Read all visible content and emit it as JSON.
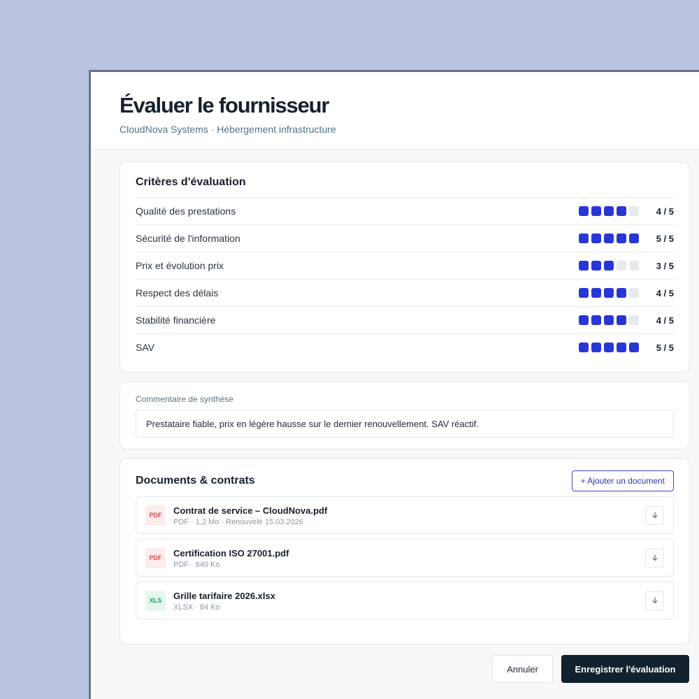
{
  "header": {
    "title": "Évaluer le fournisseur",
    "subtitle": "CloudNova Systems · Hébergement infrastructure"
  },
  "criteria": {
    "title": "Critères d'évaluation",
    "max": 5,
    "items": [
      {
        "label": "Qualité des prestations",
        "value": 4,
        "score": "4 / 5"
      },
      {
        "label": "Sécurité de l'information",
        "value": 5,
        "score": "5 / 5"
      },
      {
        "label": "Prix et évolution prix",
        "value": 3,
        "score": "3 / 5"
      },
      {
        "label": "Respect des délais",
        "value": 4,
        "score": "4 / 5"
      },
      {
        "label": "Stabilité financière",
        "value": 4,
        "score": "4 / 5"
      },
      {
        "label": "SAV",
        "value": 5,
        "score": "5 / 5"
      }
    ]
  },
  "comment": {
    "label": "Commentaire de synthèse",
    "value": "Prestataire fiable, prix en légère hausse sur le dernier renouvellement. SAV réactif."
  },
  "documents": {
    "title": "Documents & contrats",
    "add_label": "+ Ajouter un document",
    "items": [
      {
        "type": "PDF",
        "name": "Contrat de service – CloudNova.pdf",
        "meta": "PDF · 1,2 Mo · Renouvelé 15.03.2026"
      },
      {
        "type": "PDF",
        "name": "Certification ISO 27001.pdf",
        "meta": "PDF · 640 Ko"
      },
      {
        "type": "XLS",
        "name": "Grille tarifaire 2026.xlsx",
        "meta": "XLSX · 84 Ko"
      }
    ]
  },
  "footer": {
    "cancel_label": "Annuler",
    "save_label": "Enregistrer l'évaluation"
  },
  "colors": {
    "accent": "#2936d6",
    "primary_button": "#13212e",
    "pdf": "#d94d4d",
    "xls": "#21a05a"
  },
  "icons": {
    "download": "arrow-down-icon"
  }
}
